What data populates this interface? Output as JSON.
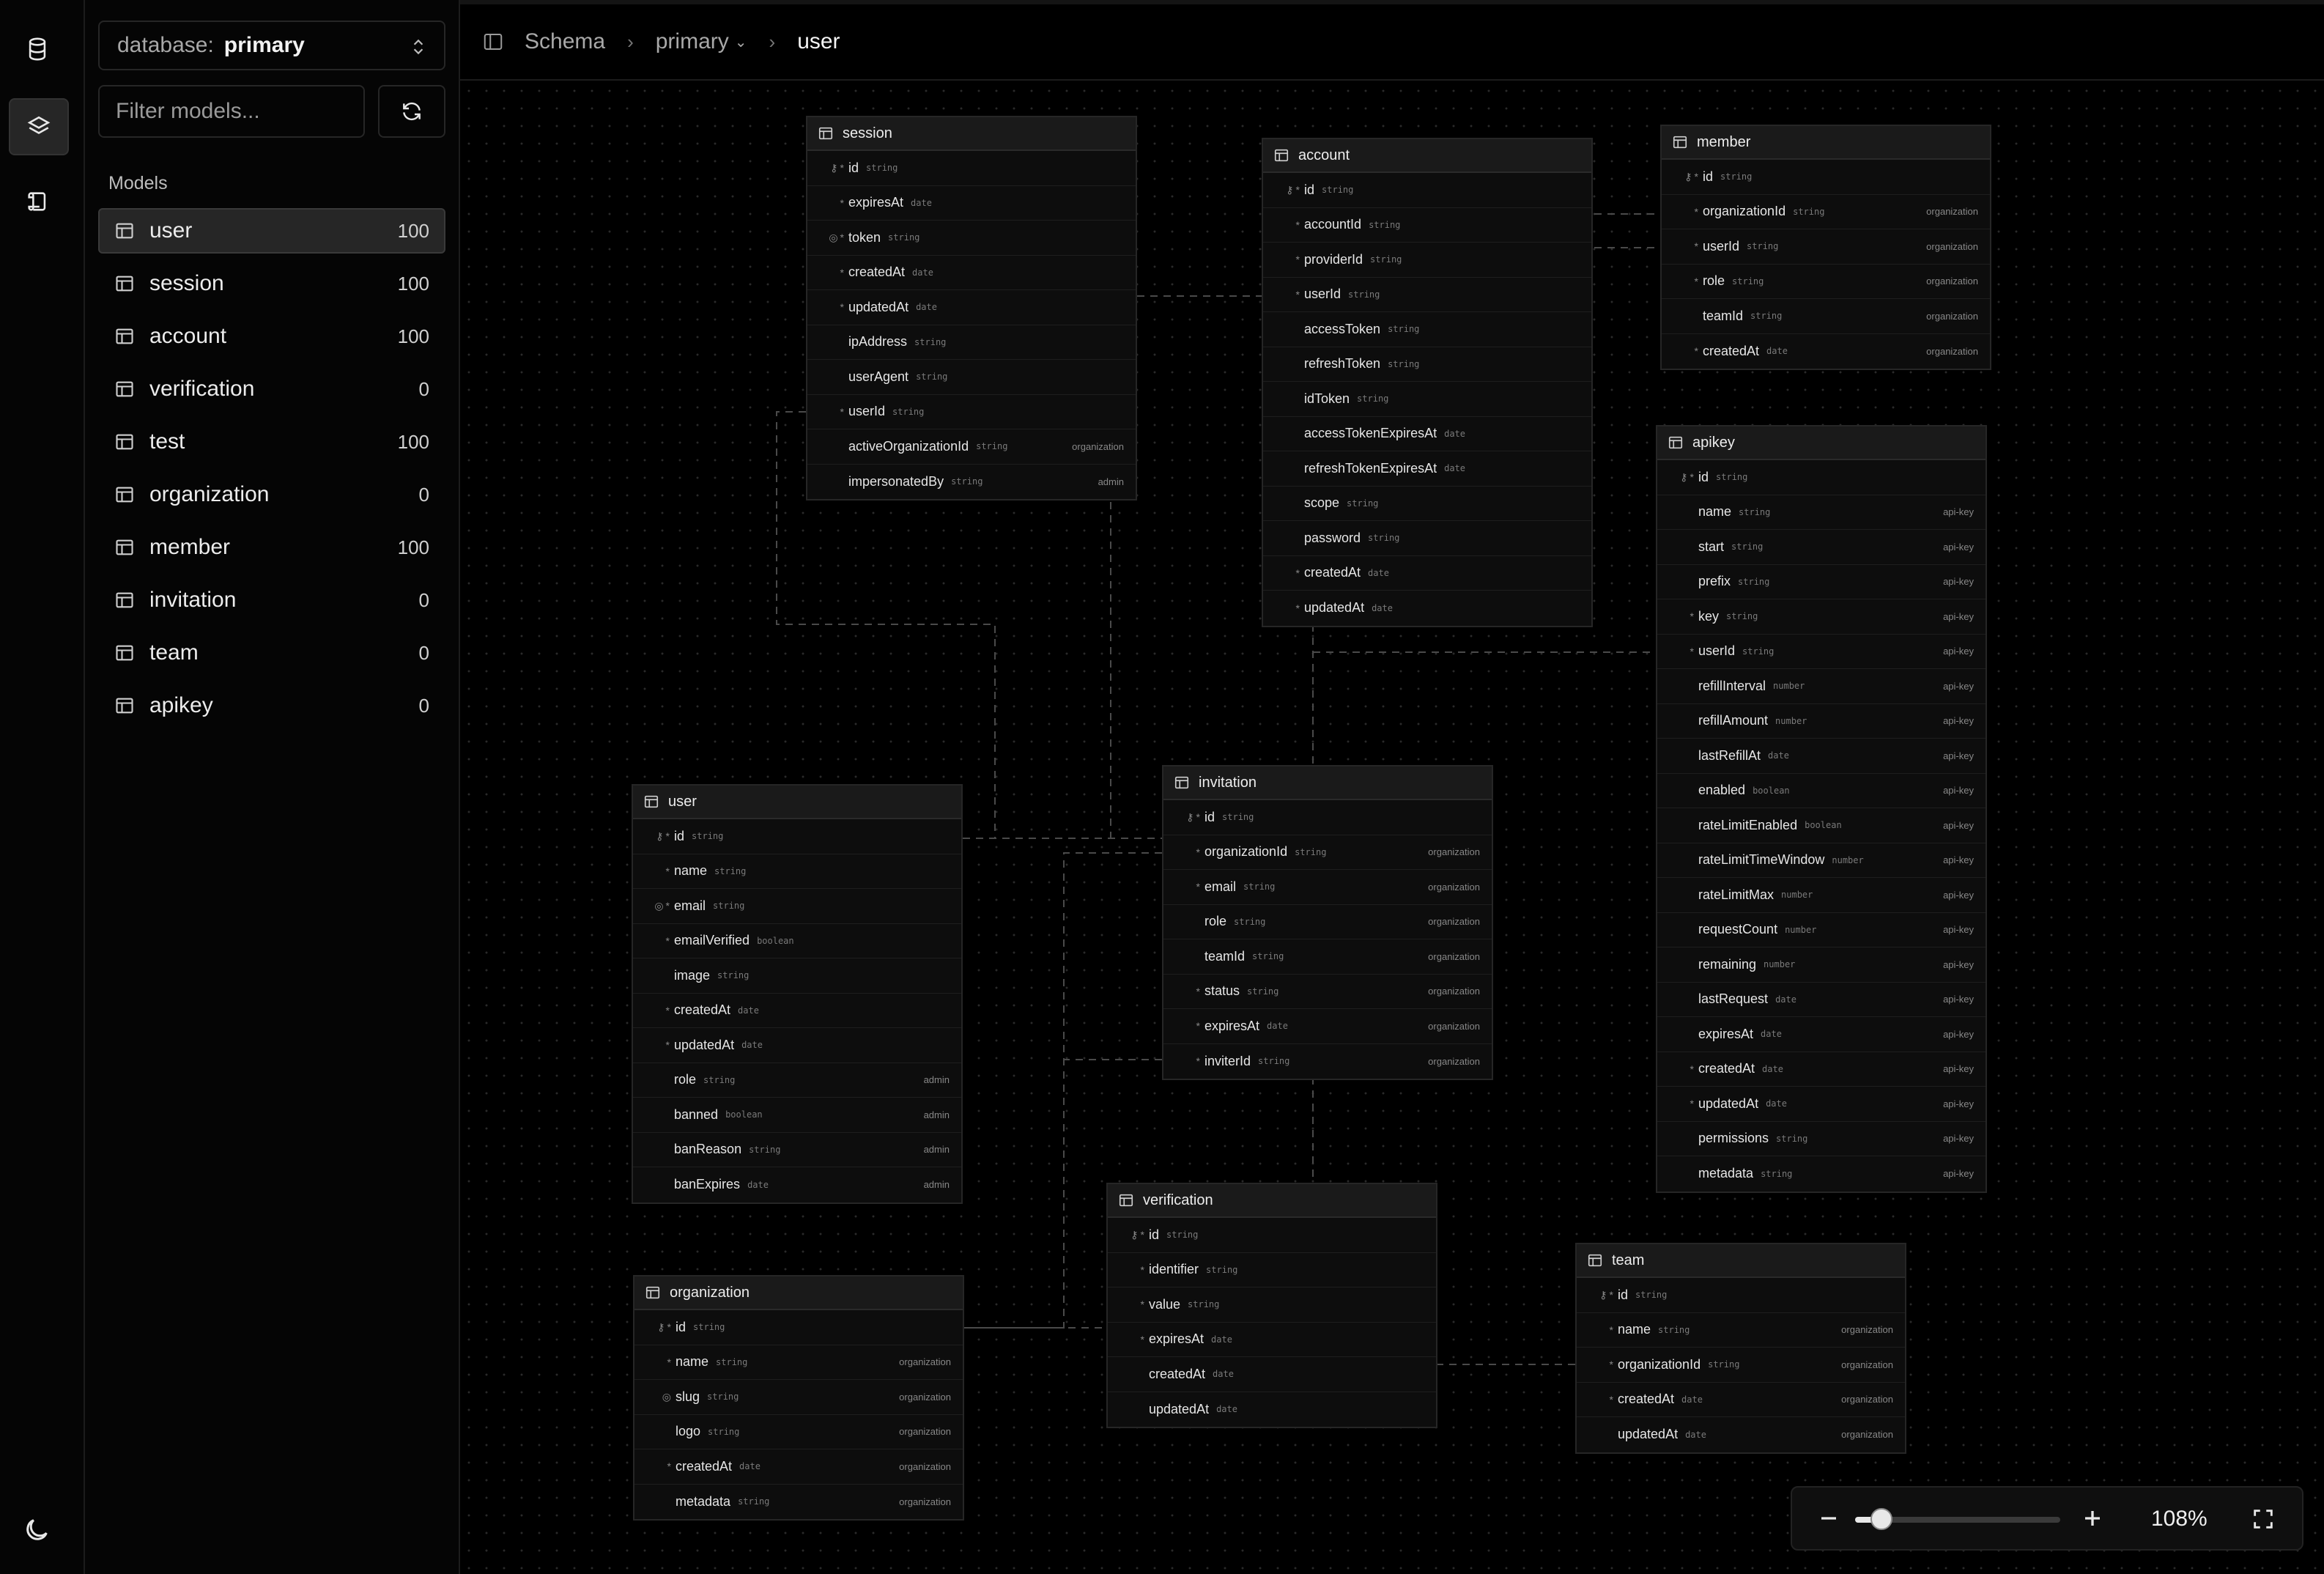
{
  "rail": {
    "icons": [
      "database-icon",
      "layers-icon",
      "scroll-icon"
    ],
    "theme_icon": "moon-icon"
  },
  "sidebar": {
    "db_label": "database:",
    "db_value": "primary",
    "filter_placeholder": "Filter models...",
    "models_title": "Models",
    "models": [
      {
        "name": "user",
        "count": "100",
        "active": true
      },
      {
        "name": "session",
        "count": "100"
      },
      {
        "name": "account",
        "count": "100"
      },
      {
        "name": "verification",
        "count": "0"
      },
      {
        "name": "test",
        "count": "100"
      },
      {
        "name": "organization",
        "count": "0"
      },
      {
        "name": "member",
        "count": "100"
      },
      {
        "name": "invitation",
        "count": "0"
      },
      {
        "name": "team",
        "count": "0"
      },
      {
        "name": "apikey",
        "count": "0"
      }
    ]
  },
  "breadcrumb": {
    "root": "Schema",
    "db": "primary",
    "current": "user"
  },
  "tables": [
    {
      "name": "session",
      "fields": [
        {
          "name": "id",
          "type": "string",
          "pk": true,
          "req": true
        },
        {
          "name": "expiresAt",
          "type": "date",
          "req": true
        },
        {
          "name": "token",
          "type": "string",
          "unique": true,
          "req": true
        },
        {
          "name": "createdAt",
          "type": "date",
          "req": true
        },
        {
          "name": "updatedAt",
          "type": "date",
          "req": true
        },
        {
          "name": "ipAddress",
          "type": "string"
        },
        {
          "name": "userAgent",
          "type": "string"
        },
        {
          "name": "userId",
          "type": "string",
          "req": true
        },
        {
          "name": "activeOrganizationId",
          "type": "string",
          "src": "organization"
        },
        {
          "name": "impersonatedBy",
          "type": "string",
          "src": "admin"
        }
      ]
    },
    {
      "name": "account",
      "fields": [
        {
          "name": "id",
          "type": "string",
          "pk": true,
          "req": true
        },
        {
          "name": "accountId",
          "type": "string",
          "req": true
        },
        {
          "name": "providerId",
          "type": "string",
          "req": true
        },
        {
          "name": "userId",
          "type": "string",
          "req": true
        },
        {
          "name": "accessToken",
          "type": "string"
        },
        {
          "name": "refreshToken",
          "type": "string"
        },
        {
          "name": "idToken",
          "type": "string"
        },
        {
          "name": "accessTokenExpiresAt",
          "type": "date"
        },
        {
          "name": "refreshTokenExpiresAt",
          "type": "date"
        },
        {
          "name": "scope",
          "type": "string"
        },
        {
          "name": "password",
          "type": "string"
        },
        {
          "name": "createdAt",
          "type": "date",
          "req": true
        },
        {
          "name": "updatedAt",
          "type": "date",
          "req": true
        }
      ]
    },
    {
      "name": "member",
      "fields": [
        {
          "name": "id",
          "type": "string",
          "pk": true,
          "req": true
        },
        {
          "name": "organizationId",
          "type": "string",
          "req": true,
          "src": "organization"
        },
        {
          "name": "userId",
          "type": "string",
          "req": true,
          "src": "organization"
        },
        {
          "name": "role",
          "type": "string",
          "req": true,
          "src": "organization"
        },
        {
          "name": "teamId",
          "type": "string",
          "src": "organization"
        },
        {
          "name": "createdAt",
          "type": "date",
          "req": true,
          "src": "organization"
        }
      ]
    },
    {
      "name": "apikey",
      "fields": [
        {
          "name": "id",
          "type": "string",
          "pk": true,
          "req": true
        },
        {
          "name": "name",
          "type": "string",
          "src": "api-key"
        },
        {
          "name": "start",
          "type": "string",
          "src": "api-key"
        },
        {
          "name": "prefix",
          "type": "string",
          "src": "api-key"
        },
        {
          "name": "key",
          "type": "string",
          "req": true,
          "src": "api-key"
        },
        {
          "name": "userId",
          "type": "string",
          "req": true,
          "src": "api-key"
        },
        {
          "name": "refillInterval",
          "type": "number",
          "src": "api-key"
        },
        {
          "name": "refillAmount",
          "type": "number",
          "src": "api-key"
        },
        {
          "name": "lastRefillAt",
          "type": "date",
          "src": "api-key"
        },
        {
          "name": "enabled",
          "type": "boolean",
          "src": "api-key"
        },
        {
          "name": "rateLimitEnabled",
          "type": "boolean",
          "src": "api-key"
        },
        {
          "name": "rateLimitTimeWindow",
          "type": "number",
          "src": "api-key"
        },
        {
          "name": "rateLimitMax",
          "type": "number",
          "src": "api-key"
        },
        {
          "name": "requestCount",
          "type": "number",
          "src": "api-key"
        },
        {
          "name": "remaining",
          "type": "number",
          "src": "api-key"
        },
        {
          "name": "lastRequest",
          "type": "date",
          "src": "api-key"
        },
        {
          "name": "expiresAt",
          "type": "date",
          "src": "api-key"
        },
        {
          "name": "createdAt",
          "type": "date",
          "req": true,
          "src": "api-key"
        },
        {
          "name": "updatedAt",
          "type": "date",
          "req": true,
          "src": "api-key"
        },
        {
          "name": "permissions",
          "type": "string",
          "src": "api-key"
        },
        {
          "name": "metadata",
          "type": "string",
          "src": "api-key"
        }
      ]
    },
    {
      "name": "user",
      "fields": [
        {
          "name": "id",
          "type": "string",
          "pk": true,
          "req": true
        },
        {
          "name": "name",
          "type": "string",
          "req": true
        },
        {
          "name": "email",
          "type": "string",
          "unique": true,
          "req": true
        },
        {
          "name": "emailVerified",
          "type": "boolean",
          "req": true
        },
        {
          "name": "image",
          "type": "string"
        },
        {
          "name": "createdAt",
          "type": "date",
          "req": true
        },
        {
          "name": "updatedAt",
          "type": "date",
          "req": true
        },
        {
          "name": "role",
          "type": "string",
          "src": "admin"
        },
        {
          "name": "banned",
          "type": "boolean",
          "src": "admin"
        },
        {
          "name": "banReason",
          "type": "string",
          "src": "admin"
        },
        {
          "name": "banExpires",
          "type": "date",
          "src": "admin"
        }
      ]
    },
    {
      "name": "invitation",
      "fields": [
        {
          "name": "id",
          "type": "string",
          "pk": true,
          "req": true
        },
        {
          "name": "organizationId",
          "type": "string",
          "req": true,
          "src": "organization"
        },
        {
          "name": "email",
          "type": "string",
          "req": true,
          "src": "organization"
        },
        {
          "name": "role",
          "type": "string",
          "src": "organization"
        },
        {
          "name": "teamId",
          "type": "string",
          "src": "organization"
        },
        {
          "name": "status",
          "type": "string",
          "req": true,
          "src": "organization"
        },
        {
          "name": "expiresAt",
          "type": "date",
          "req": true,
          "src": "organization"
        },
        {
          "name": "inviterId",
          "type": "string",
          "req": true,
          "src": "organization"
        }
      ]
    },
    {
      "name": "verification",
      "fields": [
        {
          "name": "id",
          "type": "string",
          "pk": true,
          "req": true
        },
        {
          "name": "identifier",
          "type": "string",
          "req": true
        },
        {
          "name": "value",
          "type": "string",
          "req": true
        },
        {
          "name": "expiresAt",
          "type": "date",
          "req": true
        },
        {
          "name": "createdAt",
          "type": "date"
        },
        {
          "name": "updatedAt",
          "type": "date"
        }
      ]
    },
    {
      "name": "organization",
      "fields": [
        {
          "name": "id",
          "type": "string",
          "pk": true,
          "req": true
        },
        {
          "name": "name",
          "type": "string",
          "req": true,
          "src": "organization"
        },
        {
          "name": "slug",
          "type": "string",
          "unique": true,
          "src": "organization"
        },
        {
          "name": "logo",
          "type": "string",
          "src": "organization"
        },
        {
          "name": "createdAt",
          "type": "date",
          "req": true,
          "src": "organization"
        },
        {
          "name": "metadata",
          "type": "string",
          "src": "organization"
        }
      ]
    },
    {
      "name": "team",
      "fields": [
        {
          "name": "id",
          "type": "string",
          "pk": true,
          "req": true
        },
        {
          "name": "name",
          "type": "string",
          "req": true,
          "src": "organization"
        },
        {
          "name": "organizationId",
          "type": "string",
          "req": true,
          "src": "organization"
        },
        {
          "name": "createdAt",
          "type": "date",
          "req": true,
          "src": "organization"
        },
        {
          "name": "updatedAt",
          "type": "date",
          "src": "organization"
        }
      ]
    }
  ],
  "zoom": {
    "value": "108%",
    "level": 0.13
  }
}
